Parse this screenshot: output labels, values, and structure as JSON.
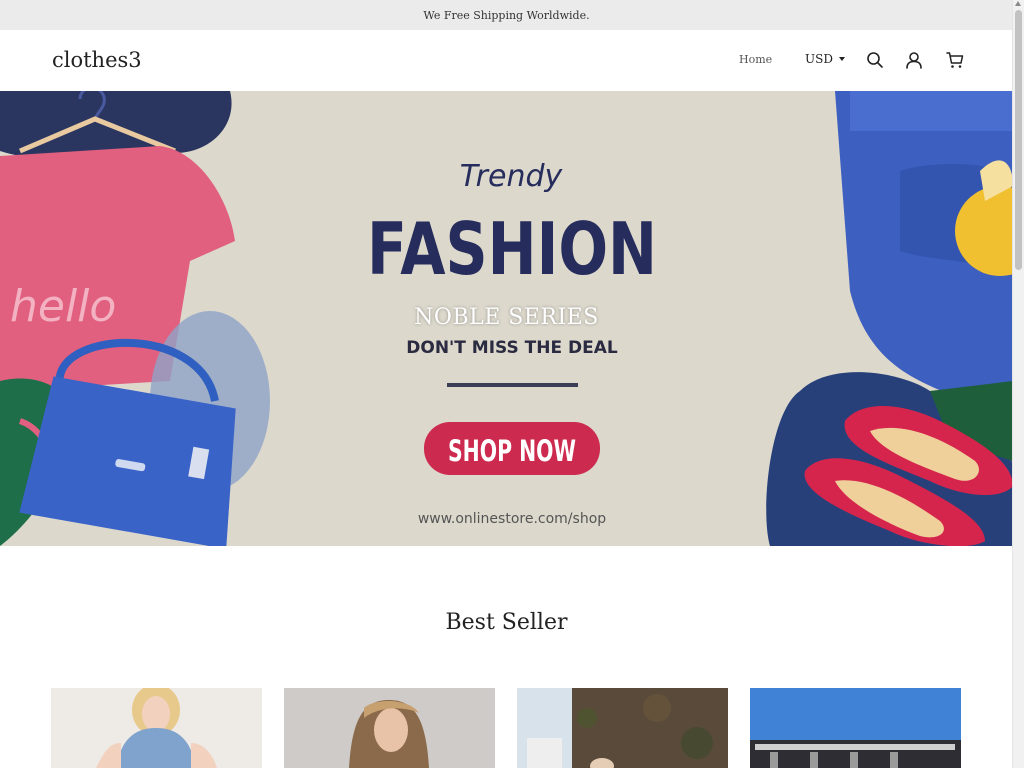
{
  "announcement": "We Free Shipping Worldwide.",
  "header": {
    "logo": "clothes3",
    "nav_home": "Home",
    "currency": "USD",
    "icons": [
      "search-icon",
      "account-icon",
      "cart-icon"
    ]
  },
  "hero": {
    "script_text": "Trendy",
    "headline": "FASHION",
    "tagline": "DON'T MISS THE DEAL",
    "cta": "SHOP NOW",
    "url": "www.onlinestore.com/shop",
    "shirt_text": "hello",
    "caption": "NOBLE SERIES"
  },
  "section": {
    "title": "Best Seller"
  },
  "colors": {
    "announcement_bg": "#ebebeb",
    "hero_bg": "#dcd8cc",
    "headline": "#262c5c",
    "cta": "#cc2a4e"
  }
}
